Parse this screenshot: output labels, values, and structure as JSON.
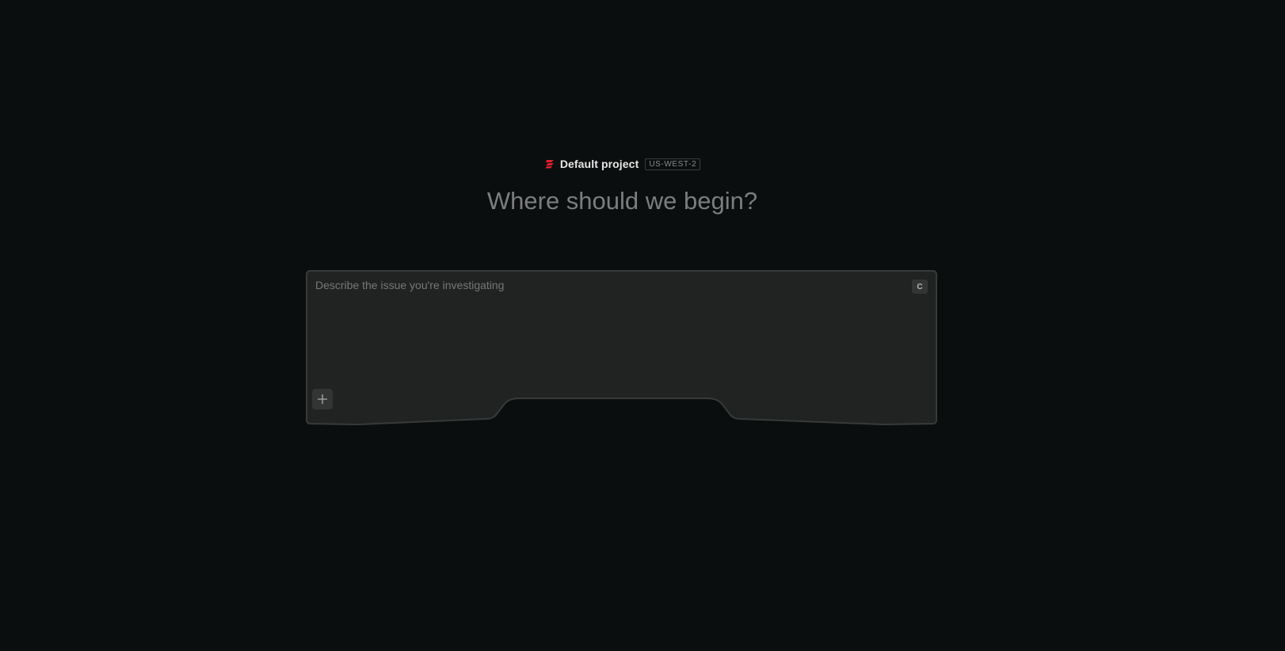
{
  "project": {
    "name": "Default project",
    "region": "US-WEST-2",
    "logo_icon": "brand-logo-icon",
    "accent_color": "#e0212c"
  },
  "headline": "Where should we begin?",
  "composer": {
    "placeholder": "Describe the issue you're investigating",
    "value": "",
    "shortcut_key": "C",
    "add_icon": "plus-icon"
  },
  "colors": {
    "background": "#0b0e0e",
    "composer_background": "#212222",
    "composer_border": "#383a3a"
  }
}
